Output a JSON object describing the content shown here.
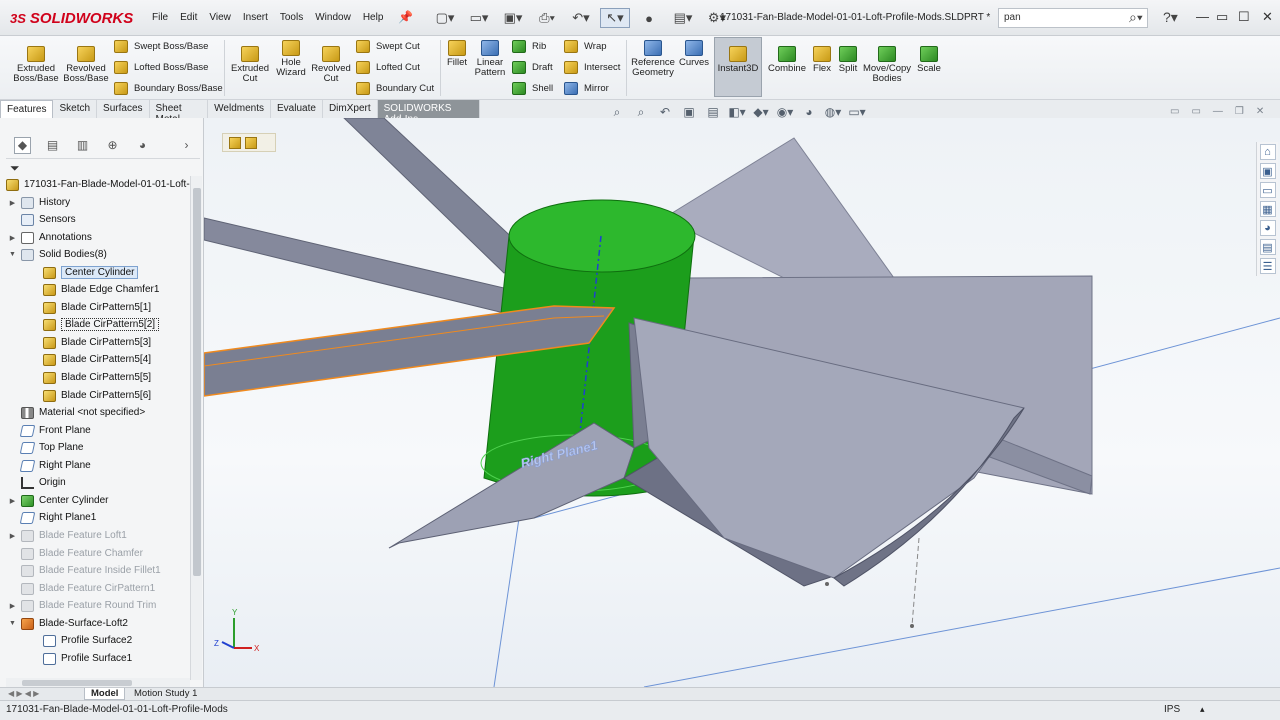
{
  "app": {
    "brand": "SOLIDWORKS",
    "brand_prefix": "3S"
  },
  "menu": [
    "File",
    "Edit",
    "View",
    "Insert",
    "Tools",
    "Window",
    "Help"
  ],
  "document_title": "171031-Fan-Blade-Model-01-01-Loft-Profile-Mods.SLDPRT *",
  "search": {
    "value": "pan"
  },
  "commands": {
    "extruded_boss": "Extruded Boss/Base",
    "revolved_boss": "Revolved Boss/Base",
    "swept_boss": "Swept Boss/Base",
    "lofted_boss": "Lofted Boss/Base",
    "boundary_boss": "Boundary Boss/Base",
    "extruded_cut": "Extruded Cut",
    "hole_wizard": "Hole Wizard",
    "revolved_cut": "Revolved Cut",
    "swept_cut": "Swept Cut",
    "lofted_cut": "Lofted Cut",
    "boundary_cut": "Boundary Cut",
    "fillet": "Fillet",
    "linear_pattern": "Linear Pattern",
    "rib": "Rib",
    "draft": "Draft",
    "shell": "Shell",
    "wrap": "Wrap",
    "intersect": "Intersect",
    "mirror": "Mirror",
    "reference_geometry": "Reference Geometry",
    "curves": "Curves",
    "instant3d": "Instant3D",
    "combine": "Combine",
    "flex": "Flex",
    "split": "Split",
    "move_copy": "Move/Copy Bodies",
    "scale": "Scale"
  },
  "tabs": [
    "Features",
    "Sketch",
    "Surfaces",
    "Sheet Metal",
    "Weldments",
    "Evaluate",
    "DimXpert",
    "SOLIDWORKS Add-Ins"
  ],
  "tree": {
    "root": "171031-Fan-Blade-Model-01-01-Loft-P...",
    "history": "History",
    "sensors": "Sensors",
    "annotations": "Annotations",
    "solid_bodies": "Solid Bodies(8)",
    "bodies": [
      "Center Cylinder",
      "Blade Edge Chamfer1",
      "Blade CirPattern5[1]",
      "Blade CirPattern5[2]",
      "Blade CirPattern5[3]",
      "Blade CirPattern5[4]",
      "Blade CirPattern5[5]",
      "Blade CirPattern5[6]"
    ],
    "material": "Material <not specified>",
    "front_plane": "Front Plane",
    "top_plane": "Top Plane",
    "right_plane": "Right Plane",
    "origin": "Origin",
    "center_cylinder": "Center Cylinder",
    "right_plane1": "Right Plane1",
    "suppressed": [
      "Blade Feature Loft1",
      "Blade Feature Chamfer",
      "Blade Feature Inside Fillet1",
      "Blade Feature CirPattern1",
      "Blade Feature Round Trim"
    ],
    "surface_loft": "Blade-Surface-Loft2",
    "profile2": "Profile Surface2",
    "profile1": "Profile Surface1"
  },
  "viewport": {
    "plane_label": "Right Plane1",
    "triad": {
      "x": "X",
      "y": "Y",
      "z": "Z"
    }
  },
  "bottom_tabs": {
    "model": "Model",
    "motion": "Motion Study 1"
  },
  "status": {
    "text": "171031-Fan-Blade-Model-01-01-Loft-Profile-Mods",
    "units": "IPS"
  },
  "colors": {
    "accent_red": "#d0021b",
    "body_green": "#1e9e1e",
    "blade_gray": "#8e93a8",
    "selection_orange": "#f08a1e"
  }
}
